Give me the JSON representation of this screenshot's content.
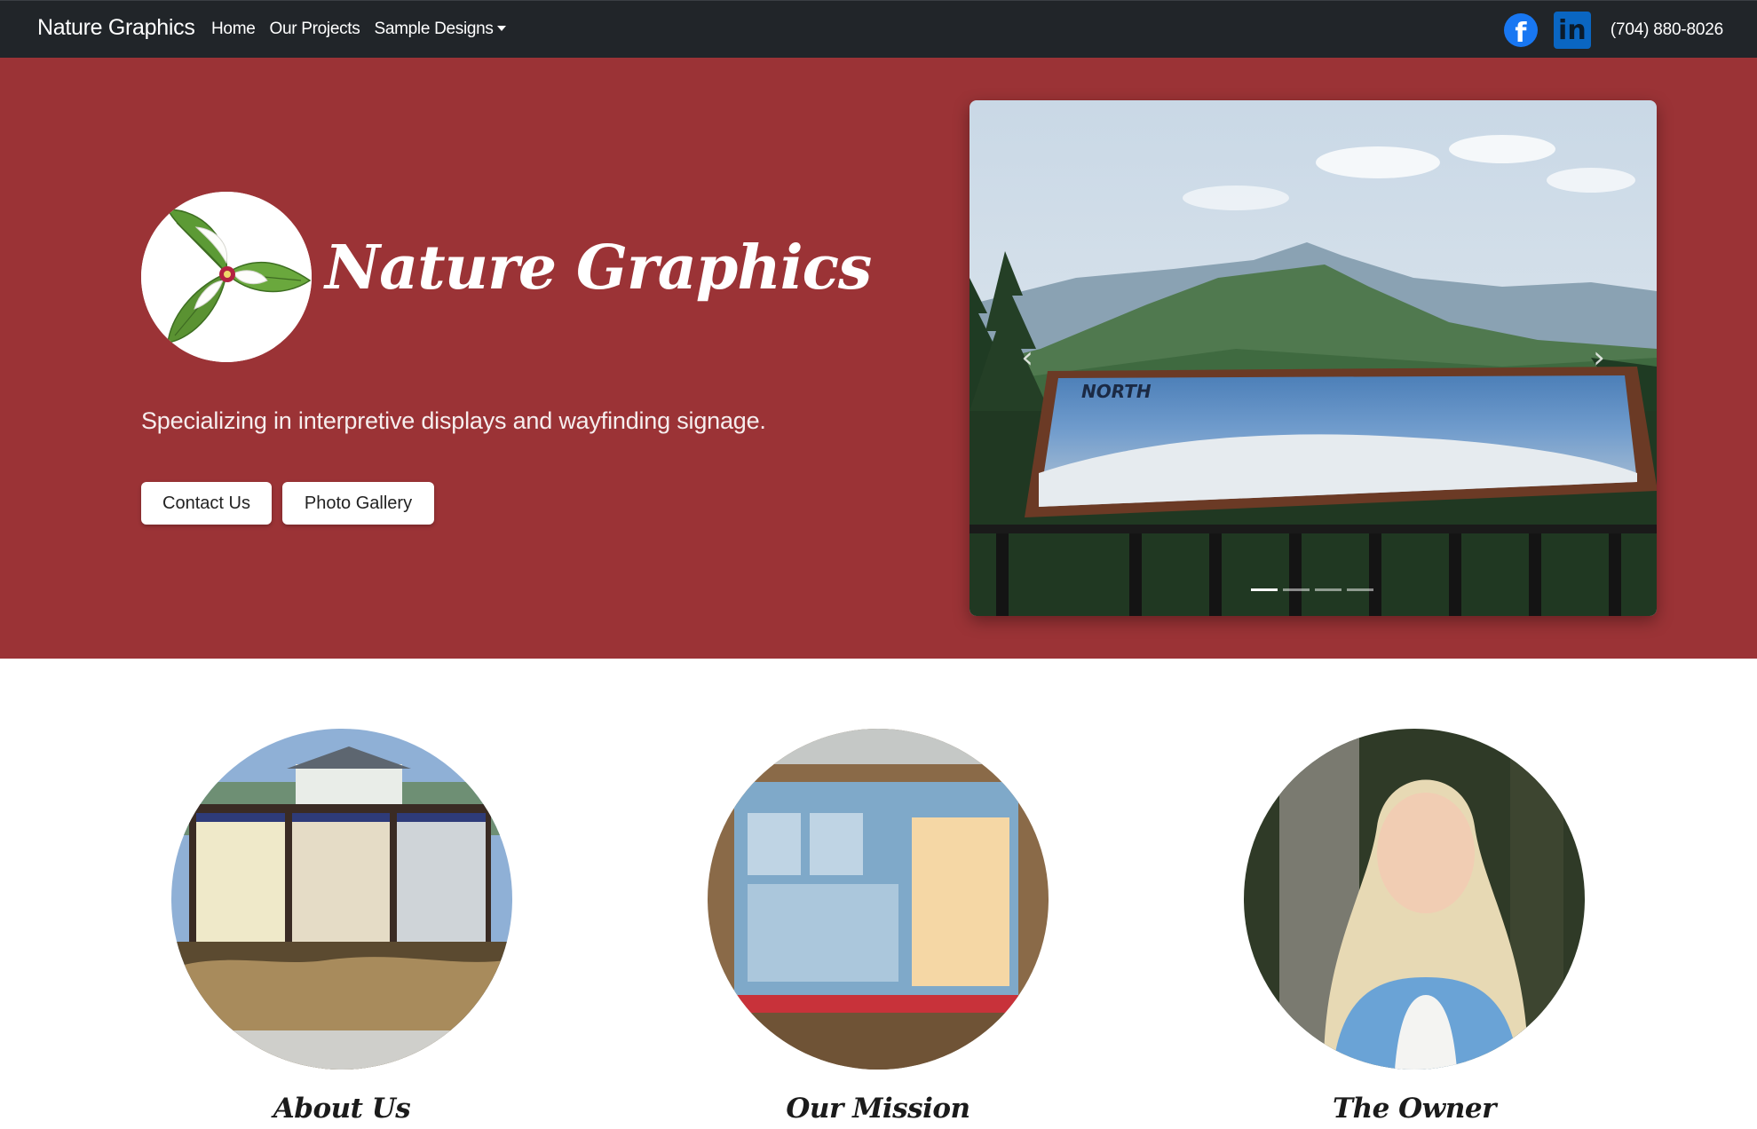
{
  "navbar": {
    "brand": "Nature Graphics",
    "links": [
      {
        "label": "Home"
      },
      {
        "label": "Our Projects"
      },
      {
        "label": "Sample Designs"
      }
    ],
    "phone": "(704) 880-8026",
    "icons": [
      "facebook-icon",
      "linkedin-icon"
    ]
  },
  "hero": {
    "title": "Nature Graphics",
    "tagline": "Specializing in interpretive displays and wayfinding signage.",
    "buttons": {
      "contact": "Contact Us",
      "gallery": "Photo Gallery"
    },
    "carousel": {
      "slide_count": 4,
      "active_index": 0,
      "sign_label": "NORTH"
    }
  },
  "features": [
    {
      "title": "About Us"
    },
    {
      "title": "Our Mission"
    },
    {
      "title": "The Owner"
    }
  ],
  "colors": {
    "navbar_bg": "#212529",
    "hero_bg": "#9b3336",
    "facebook": "#1877f2",
    "linkedin": "#0a66c2"
  }
}
